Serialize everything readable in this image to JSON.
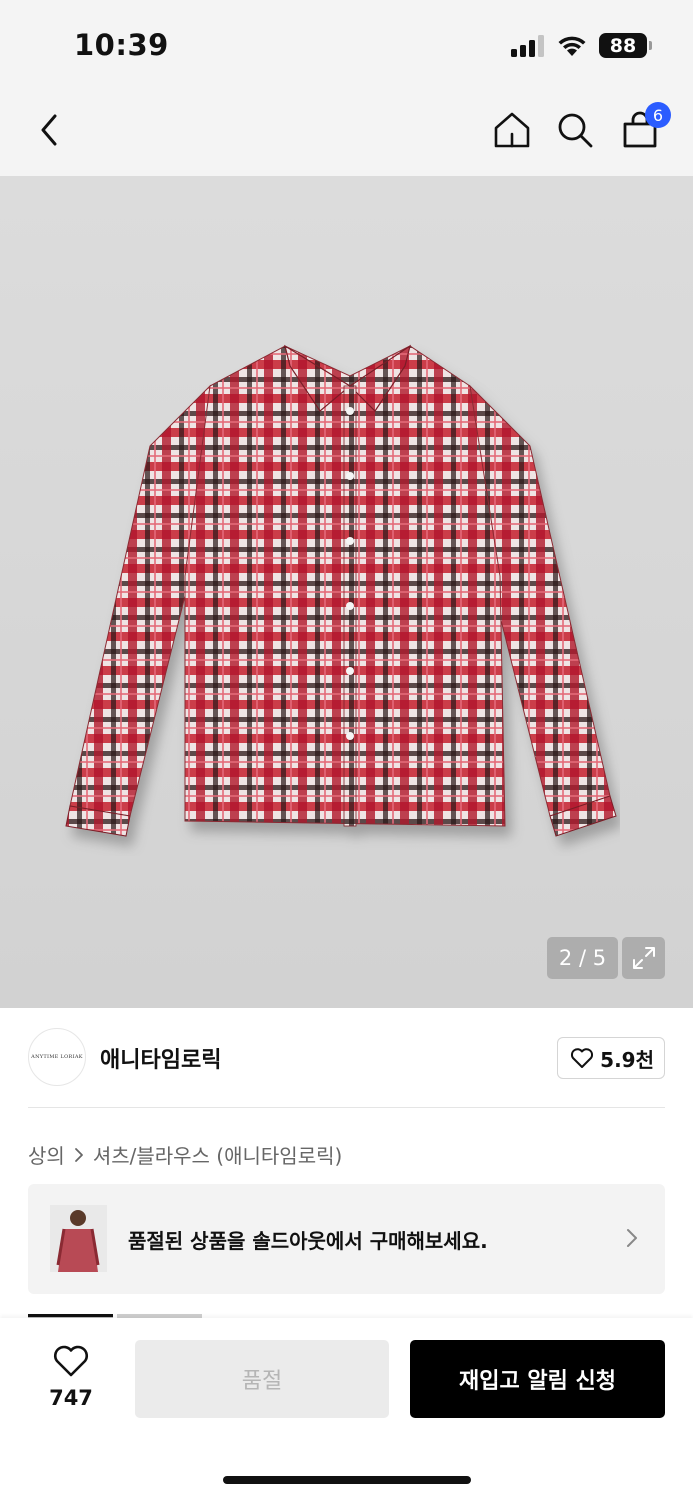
{
  "status_bar": {
    "time": "10:39",
    "battery": "88",
    "icons": [
      "signal-icon",
      "wifi-icon",
      "battery-icon"
    ]
  },
  "nav": {
    "cart_count": "6",
    "icons": [
      "back-icon",
      "home-icon",
      "search-icon",
      "shopping-bag-icon"
    ]
  },
  "gallery": {
    "counter": "2 / 5",
    "icon": "expand-icon"
  },
  "brand": {
    "logo_text": "ANYTIME LORIAK",
    "name": "애니타임로릭",
    "like_count": "5.9천"
  },
  "breadcrumb": {
    "category": "상의",
    "subcategory": "셔츠/블라우스 (애니타임로릭)"
  },
  "soldout_banner": {
    "text": "품절된 상품을 솔드아웃에서 구매해보세요."
  },
  "bottom_bar": {
    "wish_count": "747",
    "soldout_label": "품절",
    "restock_label": "재입고 알림 신청"
  },
  "colors": {
    "accent_badge": "#2b5cff",
    "primary_button": "#000000",
    "disabled_button": "#ebebeb"
  }
}
